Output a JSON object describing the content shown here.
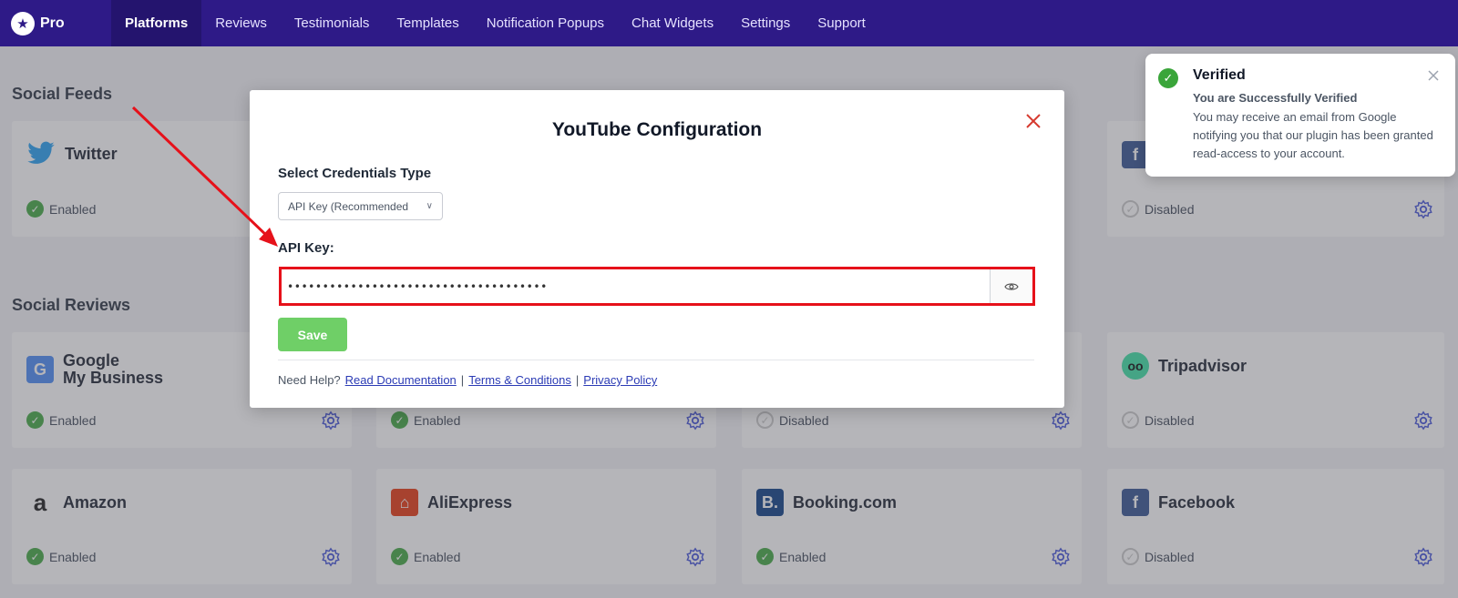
{
  "brand": {
    "name": "Pro"
  },
  "nav": [
    {
      "label": "Platforms",
      "active": true
    },
    {
      "label": "Reviews"
    },
    {
      "label": "Testimonials"
    },
    {
      "label": "Templates"
    },
    {
      "label": "Notification Popups"
    },
    {
      "label": "Chat Widgets"
    },
    {
      "label": "Settings"
    },
    {
      "label": "Support"
    }
  ],
  "sections": {
    "social_feeds": "Social Feeds",
    "social_reviews": "Social Reviews"
  },
  "cards": {
    "twitter": {
      "name": "Twitter",
      "status": "Enabled"
    },
    "feed_right": {
      "status": "Disabled"
    },
    "google": {
      "name_line1": "Google",
      "name_line2": "My Business",
      "status": "Enabled"
    },
    "review2": {
      "status": "Enabled"
    },
    "review3": {
      "status": "Disabled"
    },
    "tripadvisor": {
      "name": "Tripadvisor",
      "status": "Disabled"
    },
    "amazon": {
      "name": "Amazon",
      "status": "Enabled"
    },
    "aliexpress": {
      "name": "AliExpress",
      "status": "Enabled"
    },
    "booking": {
      "name": "Booking.com",
      "status": "Enabled"
    },
    "facebook": {
      "name": "Facebook",
      "status": "Disabled"
    }
  },
  "modal": {
    "title": "YouTube Configuration",
    "credentials_label": "Select Credentials Type",
    "credentials_value": "API Key (Recommended",
    "api_key_label": "API Key:",
    "api_key_value": "•••••••••••••••••••••••••••••••••••••",
    "save_label": "Save",
    "help_prefix": "Need Help?",
    "link_docs": "Read Documentation",
    "separator": "|",
    "link_terms": "Terms & Conditions",
    "link_privacy": "Privacy Policy"
  },
  "toast": {
    "title": "Verified",
    "subtitle": "You are Successfully Verified",
    "body": "You may receive an email from Google notifying you that our plugin has been granted read-access to your account."
  },
  "colors": {
    "nav_bg": "#2e1a87",
    "enabled": "#3aa53a",
    "highlight": "#e6111a",
    "save": "#6fcf67"
  }
}
